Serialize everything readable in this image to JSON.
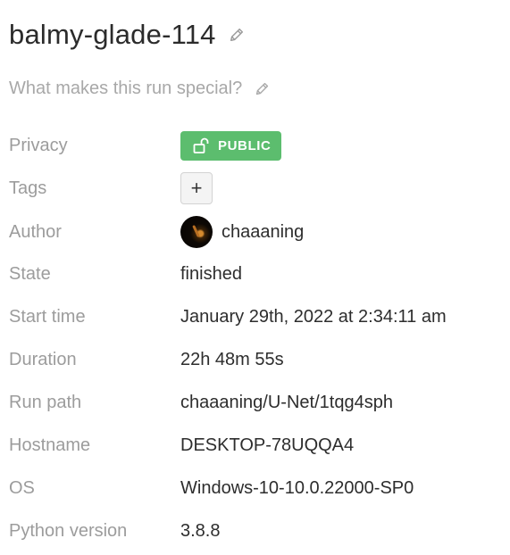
{
  "run": {
    "name": "balmy-glade-114",
    "description_placeholder": "What makes this run special?"
  },
  "overview": {
    "privacy": {
      "label": "Privacy",
      "value": "PUBLIC"
    },
    "tags": {
      "label": "Tags",
      "add_label": "+"
    },
    "author": {
      "label": "Author",
      "value": "chaaaning"
    },
    "state": {
      "label": "State",
      "value": "finished"
    },
    "start_time": {
      "label": "Start time",
      "value": "January 29th, 2022 at 2:34:11 am"
    },
    "duration": {
      "label": "Duration",
      "value": "22h 48m 55s"
    },
    "run_path": {
      "label": "Run path",
      "value": "chaaaning/U-Net/1tqg4sph"
    },
    "hostname": {
      "label": "Hostname",
      "value": "DESKTOP-78UQQA4"
    },
    "os": {
      "label": "OS",
      "value": "Windows-10-10.0.22000-SP0"
    },
    "python_version": {
      "label": "Python version",
      "value": "3.8.8"
    }
  },
  "icons": {
    "edit_title": "pencil-icon",
    "edit_description": "pencil-icon",
    "privacy": "unlock-icon"
  },
  "colors": {
    "public_badge": "#5cbd6e",
    "label_text": "#9c9c9c",
    "value_text": "#2d2d2d",
    "placeholder_text": "#a8a8a8"
  }
}
